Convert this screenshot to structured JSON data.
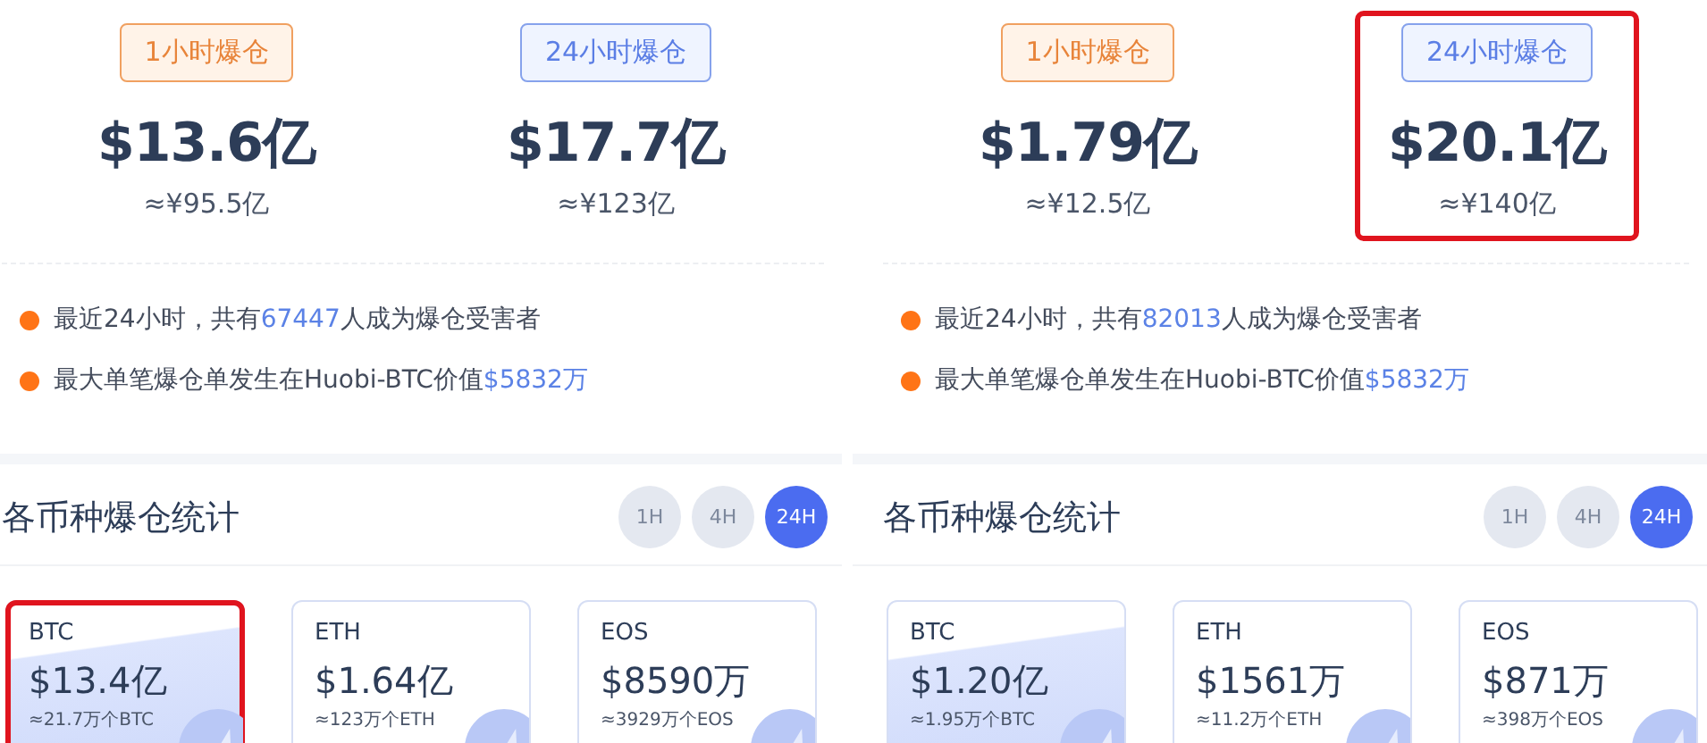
{
  "panels": [
    {
      "periods": [
        {
          "label": "1小时爆仓",
          "kind": "hour",
          "amount": "$13.6亿",
          "approx": "≈¥95.5亿",
          "highlighted": false
        },
        {
          "label": "24小时爆仓",
          "kind": "day",
          "amount": "$17.7亿",
          "approx": "≈¥123亿",
          "highlighted": false
        }
      ],
      "facts": [
        {
          "before": "最近24小时，共有",
          "value": "67447",
          "after": "人成为爆仓受害者"
        },
        {
          "before": "最大单笔爆仓单发生在Huobi-BTC价值",
          "value": "$5832万"
        }
      ],
      "section_title": "各币种爆仓统计",
      "time_filters": [
        {
          "label": "1H",
          "selected": false
        },
        {
          "label": "4H",
          "selected": false
        },
        {
          "label": "24H",
          "selected": true
        }
      ],
      "coins": [
        {
          "name": "BTC",
          "amount": "$13.4亿",
          "approx": "≈21.7万个BTC",
          "featured": true,
          "highlighted": true
        },
        {
          "name": "ETH",
          "amount": "$1.64亿",
          "approx": "≈123万个ETH",
          "featured": false,
          "highlighted": false
        },
        {
          "name": "EOS",
          "amount": "$8590万",
          "approx": "≈3929万个EOS",
          "featured": false,
          "highlighted": false
        }
      ]
    },
    {
      "periods": [
        {
          "label": "1小时爆仓",
          "kind": "hour",
          "amount": "$1.79亿",
          "approx": "≈¥12.5亿",
          "highlighted": false
        },
        {
          "label": "24小时爆仓",
          "kind": "day",
          "amount": "$20.1亿",
          "approx": "≈¥140亿",
          "highlighted": true
        }
      ],
      "facts": [
        {
          "before": "最近24小时，共有",
          "value": "82013",
          "after": "人成为爆仓受害者"
        },
        {
          "before": "最大单笔爆仓单发生在Huobi-BTC价值",
          "value": "$5832万"
        }
      ],
      "section_title": "各币种爆仓统计",
      "time_filters": [
        {
          "label": "1H",
          "selected": false
        },
        {
          "label": "4H",
          "selected": false
        },
        {
          "label": "24H",
          "selected": true
        }
      ],
      "coins": [
        {
          "name": "BTC",
          "amount": "$1.20亿",
          "approx": "≈1.95万个BTC",
          "featured": true,
          "highlighted": false
        },
        {
          "name": "ETH",
          "amount": "$1561万",
          "approx": "≈11.2万个ETH",
          "featured": false,
          "highlighted": false
        },
        {
          "name": "EOS",
          "amount": "$871万",
          "approx": "≈398万个EOS",
          "featured": false,
          "highlighted": false
        }
      ]
    }
  ]
}
